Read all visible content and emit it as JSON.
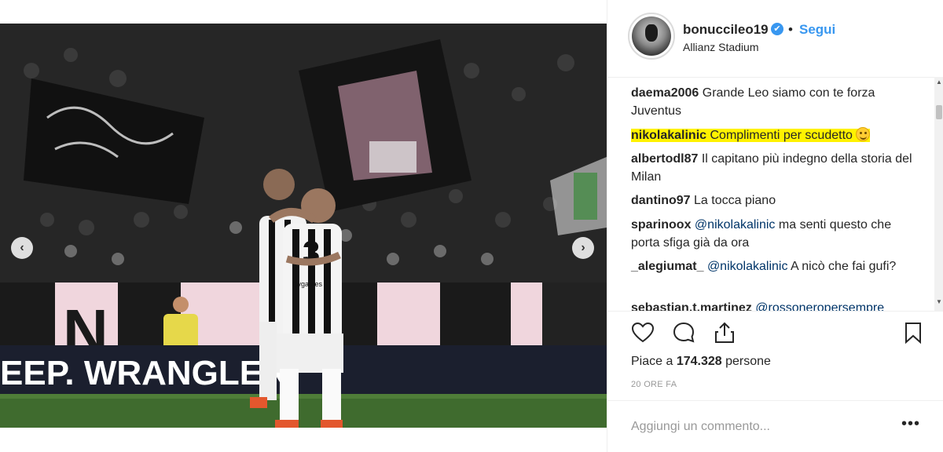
{
  "photo": {
    "banner_text": "EEP. WRANGLER",
    "jersey_number": "3",
    "sponsor": "Cygames",
    "carousel_dots": 4,
    "active_dot": 1
  },
  "header": {
    "username": "bonuccileo19",
    "separator": "•",
    "follow_label": "Segui",
    "location": "Allianz Stadium"
  },
  "comments": [
    {
      "user": "daema2006",
      "text": "Grande Leo siamo con te forza Juventus",
      "highlighted": false
    },
    {
      "user": "nikolakalinic",
      "text": "Complimenti per scudetto",
      "highlighted": true,
      "emoji": "smile-emoji"
    },
    {
      "user": "albertodl87",
      "text": "Il capitano più indegno della storia del Milan",
      "highlighted": false
    },
    {
      "user": "dantino97",
      "text": "La tocca piano",
      "highlighted": false
    },
    {
      "user": "sparinoox",
      "mention": "@nikolakalinic",
      "text": "ma senti questo che porta sfiga già da ora",
      "highlighted": false
    },
    {
      "user": "_alegiumat_",
      "mention": "@nikolakalinic",
      "text": "A nicò che fai gufi?",
      "highlighted": false
    },
    {
      "user": "sebastian.t.martinez",
      "mention": "@rossoneropersempre",
      "text": "",
      "highlighted": false
    }
  ],
  "actions": {
    "like_icon": "heart-icon",
    "comment_icon": "comment-icon",
    "share_icon": "share-icon",
    "save_icon": "bookmark-icon"
  },
  "likes": {
    "prefix": "Piace a",
    "count": "174.328",
    "suffix": "persone"
  },
  "timestamp": "20 ORE FA",
  "add_comment": {
    "placeholder": "Aggiungi un commento...",
    "more_label": "•••"
  },
  "colors": {
    "link": "#3897f0",
    "highlight": "#fff200",
    "text": "#262626",
    "muted": "#999999"
  }
}
